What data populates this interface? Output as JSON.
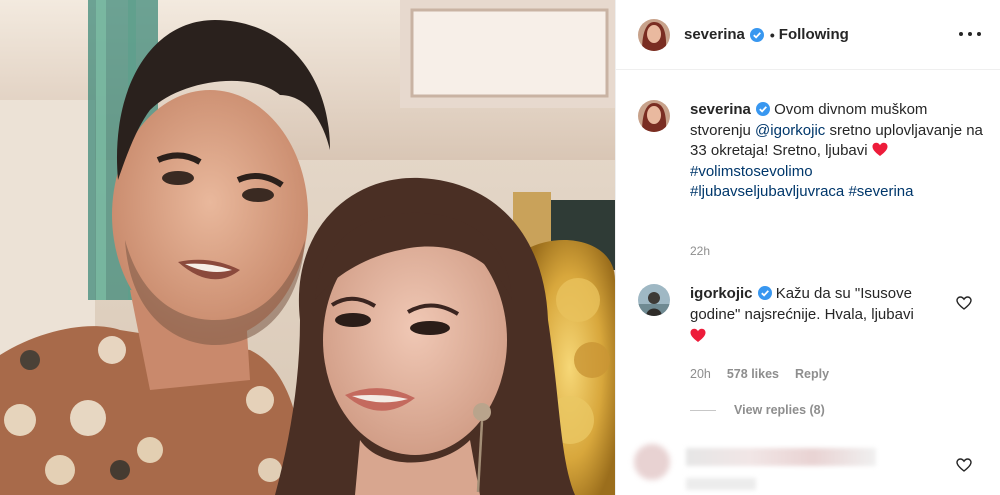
{
  "post": {
    "username": "severina",
    "follow_status": "Following",
    "dot": "•"
  },
  "caption": {
    "username": "severina",
    "text_before": "Ovom divnom muškom stvorenju",
    "mention": "@igorkojic",
    "text_after": "sretno uplovljavanje na 33 okretaja! Sretno, ljubavi",
    "hashtag1": "#volimstosevolimo",
    "hashtag2": "#ljubavseljubavljuvraca",
    "hashtag3": "#severina",
    "time": "22h"
  },
  "comment": {
    "username": "igorkojic",
    "text": "Kažu da su \"Isusove godine\" najsrećnije. Hvala, ljubavi",
    "time": "20h",
    "likes": "578 likes",
    "reply": "Reply",
    "view_replies": "View replies (8)"
  },
  "icons": {
    "verified": "verified-badge-icon",
    "heart": "red-heart-emoji-icon",
    "like": "heart-outline-icon",
    "more": "more-options-icon"
  },
  "colors": {
    "verified": "#3897f0",
    "link": "#00376b",
    "heart": "#ed1c3a",
    "muted": "#8e8e8e"
  }
}
